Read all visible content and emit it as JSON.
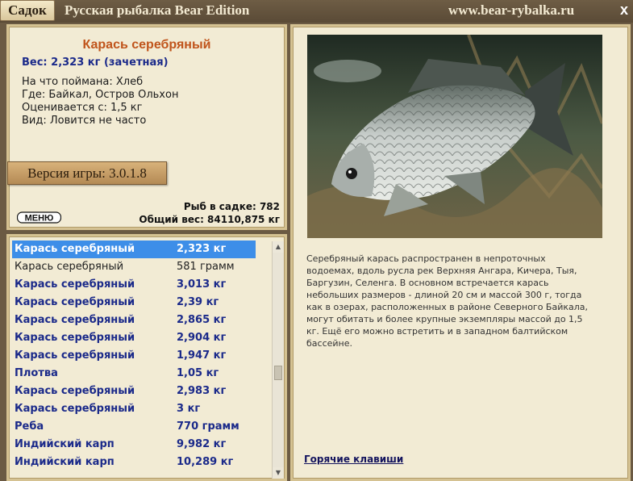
{
  "titlebar": {
    "tab": "Садок",
    "title": "Русская рыбалка Bear Edition",
    "url": "www.bear-rybalka.ru",
    "close": "x"
  },
  "info": {
    "fish_name": "Карась серебряный",
    "weight_line": "Вес: 2,323 кг (зачетная)",
    "bait": "На что поймана: Хлеб",
    "location": "Где: Байкал, Остров Ольхон",
    "value": "Оценивается с: 1,5 кг",
    "kind": "Вид: Ловится не часто",
    "version": "Версия игры: 3.0.1.8",
    "menu_logo": "МЕНЮ",
    "fish_count": "Рыб в садке: 782",
    "total_weight": "Общий вес: 84110,875 кг"
  },
  "list": {
    "rows": [
      {
        "name": "Карась серебряный",
        "weight": "2,323 кг",
        "state": "selected"
      },
      {
        "name": "Карась серебряный",
        "weight": "581 грамм",
        "state": "plain"
      },
      {
        "name": "Карась серебряный",
        "weight": "3,013 кг",
        "state": "caught"
      },
      {
        "name": "Карась серебряный",
        "weight": "2,39 кг",
        "state": "caught"
      },
      {
        "name": "Карась серебряный",
        "weight": "2,865 кг",
        "state": "caught"
      },
      {
        "name": "Карась серебряный",
        "weight": "2,904 кг",
        "state": "caught"
      },
      {
        "name": "Карась серебряный",
        "weight": "1,947 кг",
        "state": "caught"
      },
      {
        "name": "Плотва",
        "weight": "1,05 кг",
        "state": "caught"
      },
      {
        "name": "Карась серебряный",
        "weight": "2,983 кг",
        "state": "caught"
      },
      {
        "name": "Карась серебряный",
        "weight": "3 кг",
        "state": "caught"
      },
      {
        "name": "Реба",
        "weight": "770 грамм",
        "state": "caught"
      },
      {
        "name": "Индийский карп",
        "weight": "9,982 кг",
        "state": "caught"
      },
      {
        "name": "Индийский карп",
        "weight": "10,289 кг",
        "state": "caught"
      }
    ],
    "scroll_up": "▲",
    "scroll_down": "▼"
  },
  "right": {
    "description": "Серебряный карась распространен в непроточных водоемах, вдоль русла рек Верхняя Ангара, Кичера, Тыя, Баргузин, Селенга. В основном встречается карась небольших размеров - длиной 20 см и массой 300 г, тогда как в озерах, расположенных в районе Северного Байкала, могут обитать и более крупные экземпляры массой до 1,5 кг. Ещё его можно встретить и в западном балтийском бассейне.",
    "hotkeys": "Горячие клавиши"
  },
  "colors": {
    "frame": "#6b5a43",
    "panel": "#f2ebd4",
    "fish_name": "#c0541b",
    "caught_text": "#1b2a8a",
    "selected_row": "#3d8ee8"
  }
}
